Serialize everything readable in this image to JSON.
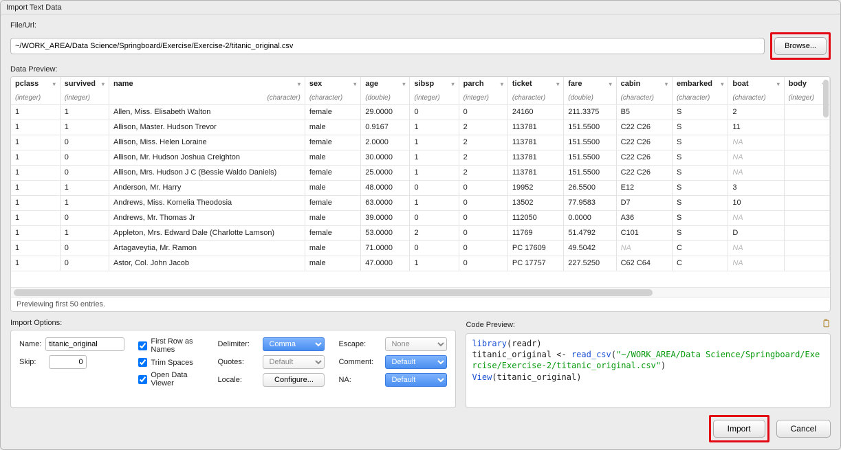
{
  "window": {
    "title": "Import Text Data"
  },
  "file": {
    "label": "File/Url:",
    "value": "~/WORK_AREA/Data Science/Springboard/Exercise/Exercise-2/titanic_original.csv",
    "browse_label": "Browse..."
  },
  "preview": {
    "label": "Data Preview:",
    "footer": "Previewing first 50 entries.",
    "columns": [
      {
        "name": "pclass",
        "type": "(integer)",
        "cls": "c-pclass",
        "align": "num"
      },
      {
        "name": "survived",
        "type": "(integer)",
        "cls": "c-survived",
        "align": "num"
      },
      {
        "name": "name",
        "type": "(character)",
        "cls": "c-name",
        "align": "txt",
        "typeRight": true
      },
      {
        "name": "sex",
        "type": "(character)",
        "cls": "c-sex",
        "align": "txt"
      },
      {
        "name": "age",
        "type": "(double)",
        "cls": "c-age",
        "align": "num"
      },
      {
        "name": "sibsp",
        "type": "(integer)",
        "cls": "c-sibsp",
        "align": "num"
      },
      {
        "name": "parch",
        "type": "(integer)",
        "cls": "c-parch",
        "align": "num"
      },
      {
        "name": "ticket",
        "type": "(character)",
        "cls": "c-ticket",
        "align": "txt"
      },
      {
        "name": "fare",
        "type": "(double)",
        "cls": "c-fare",
        "align": "num"
      },
      {
        "name": "cabin",
        "type": "(character)",
        "cls": "c-cabin",
        "align": "txt"
      },
      {
        "name": "embarked",
        "type": "(character)",
        "cls": "c-embarked",
        "align": "txt"
      },
      {
        "name": "boat",
        "type": "(character)",
        "cls": "c-boat",
        "align": "txt"
      },
      {
        "name": "body",
        "type": "(integer)",
        "cls": "c-body",
        "align": "num"
      }
    ],
    "rows": [
      {
        "pclass": "1",
        "survived": "1",
        "name": "Allen, Miss. Elisabeth Walton",
        "sex": "female",
        "age": "29.0000",
        "sibsp": "0",
        "parch": "0",
        "ticket": "24160",
        "fare": "211.3375",
        "cabin": "B5",
        "embarked": "S",
        "boat": "2",
        "body": ""
      },
      {
        "pclass": "1",
        "survived": "1",
        "name": "Allison, Master. Hudson Trevor",
        "sex": "male",
        "age": "0.9167",
        "sibsp": "1",
        "parch": "2",
        "ticket": "113781",
        "fare": "151.5500",
        "cabin": "C22 C26",
        "embarked": "S",
        "boat": "11",
        "body": ""
      },
      {
        "pclass": "1",
        "survived": "0",
        "name": "Allison, Miss. Helen Loraine",
        "sex": "female",
        "age": "2.0000",
        "sibsp": "1",
        "parch": "2",
        "ticket": "113781",
        "fare": "151.5500",
        "cabin": "C22 C26",
        "embarked": "S",
        "boat": "NA",
        "body": ""
      },
      {
        "pclass": "1",
        "survived": "0",
        "name": "Allison, Mr. Hudson Joshua Creighton",
        "sex": "male",
        "age": "30.0000",
        "sibsp": "1",
        "parch": "2",
        "ticket": "113781",
        "fare": "151.5500",
        "cabin": "C22 C26",
        "embarked": "S",
        "boat": "NA",
        "body": ""
      },
      {
        "pclass": "1",
        "survived": "0",
        "name": "Allison, Mrs. Hudson J C (Bessie Waldo Daniels)",
        "sex": "female",
        "age": "25.0000",
        "sibsp": "1",
        "parch": "2",
        "ticket": "113781",
        "fare": "151.5500",
        "cabin": "C22 C26",
        "embarked": "S",
        "boat": "NA",
        "body": ""
      },
      {
        "pclass": "1",
        "survived": "1",
        "name": "Anderson, Mr. Harry",
        "sex": "male",
        "age": "48.0000",
        "sibsp": "0",
        "parch": "0",
        "ticket": "19952",
        "fare": "26.5500",
        "cabin": "E12",
        "embarked": "S",
        "boat": "3",
        "body": ""
      },
      {
        "pclass": "1",
        "survived": "1",
        "name": "Andrews, Miss. Kornelia Theodosia",
        "sex": "female",
        "age": "63.0000",
        "sibsp": "1",
        "parch": "0",
        "ticket": "13502",
        "fare": "77.9583",
        "cabin": "D7",
        "embarked": "S",
        "boat": "10",
        "body": ""
      },
      {
        "pclass": "1",
        "survived": "0",
        "name": "Andrews, Mr. Thomas Jr",
        "sex": "male",
        "age": "39.0000",
        "sibsp": "0",
        "parch": "0",
        "ticket": "112050",
        "fare": "0.0000",
        "cabin": "A36",
        "embarked": "S",
        "boat": "NA",
        "body": ""
      },
      {
        "pclass": "1",
        "survived": "1",
        "name": "Appleton, Mrs. Edward Dale (Charlotte Lamson)",
        "sex": "female",
        "age": "53.0000",
        "sibsp": "2",
        "parch": "0",
        "ticket": "11769",
        "fare": "51.4792",
        "cabin": "C101",
        "embarked": "S",
        "boat": "D",
        "body": ""
      },
      {
        "pclass": "1",
        "survived": "0",
        "name": "Artagaveytia, Mr. Ramon",
        "sex": "male",
        "age": "71.0000",
        "sibsp": "0",
        "parch": "0",
        "ticket": "PC 17609",
        "fare": "49.5042",
        "cabin": "NA",
        "embarked": "C",
        "boat": "NA",
        "body": ""
      },
      {
        "pclass": "1",
        "survived": "0",
        "name": "Astor, Col. John Jacob",
        "sex": "male",
        "age": "47.0000",
        "sibsp": "1",
        "parch": "0",
        "ticket": "PC 17757",
        "fare": "227.5250",
        "cabin": "C62 C64",
        "embarked": "C",
        "boat": "NA",
        "body": ""
      }
    ]
  },
  "options": {
    "label": "Import Options:",
    "name_label": "Name:",
    "name_value": "titanic_original",
    "skip_label": "Skip:",
    "skip_value": "0",
    "first_row": "First Row as Names",
    "trim_spaces": "Trim Spaces",
    "open_viewer": "Open Data Viewer",
    "delimiter_label": "Delimiter:",
    "delimiter_value": "Comma",
    "quotes_label": "Quotes:",
    "quotes_value": "Default",
    "locale_label": "Locale:",
    "locale_button": "Configure...",
    "escape_label": "Escape:",
    "escape_value": "None",
    "comment_label": "Comment:",
    "comment_value": "Default",
    "na_label": "NA:",
    "na_value": "Default"
  },
  "code": {
    "label": "Code Preview:",
    "lib_fn": "library",
    "lib_arg": "readr",
    "assign_lhs": "titanic_original",
    "assign_op": " <- ",
    "read_fn": "read_csv",
    "read_arg_str": "\"~/WORK_AREA/Data Science/Springboard/Exercise/Exercise-2/titanic_original.csv\"",
    "view_fn": "View",
    "view_arg": "titanic_original"
  },
  "buttons": {
    "import": "Import",
    "cancel": "Cancel"
  }
}
